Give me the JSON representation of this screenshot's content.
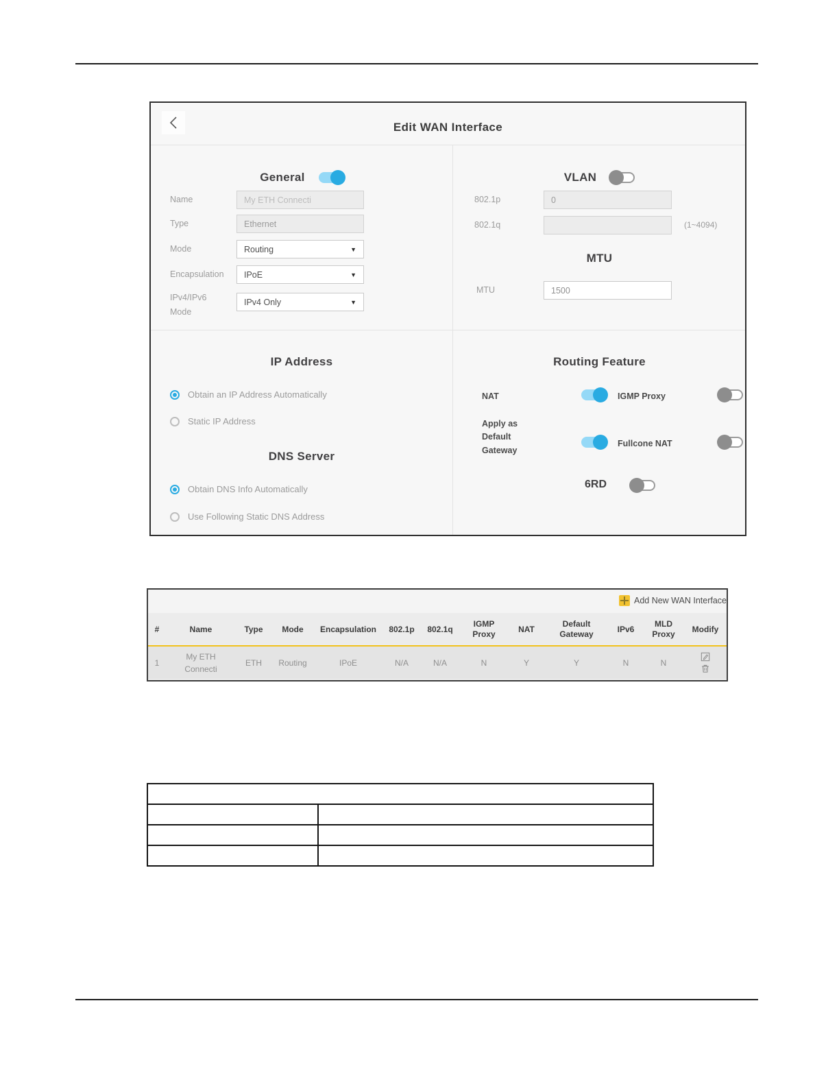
{
  "dialog": {
    "title": "Edit WAN Interface",
    "general": {
      "heading": "General",
      "name_label": "Name",
      "name_value": "My ETH Connecti",
      "type_label": "Type",
      "type_value": "Ethernet",
      "mode_label": "Mode",
      "mode_value": "Routing",
      "encap_label": "Encapsulation",
      "encap_value": "IPoE",
      "ipmode_label": "IPv4/IPv6 Mode",
      "ipmode_value": "IPv4 Only"
    },
    "vlan": {
      "heading": "VLAN",
      "p_label": "802.1p",
      "p_value": "0",
      "q_label": "802.1q",
      "q_hint": "(1~4094)"
    },
    "mtu": {
      "heading": "MTU",
      "label": "MTU",
      "value": "1500"
    },
    "ip": {
      "heading": "IP Address",
      "opt_auto": "Obtain an IP Address Automatically",
      "opt_static": "Static IP Address"
    },
    "dns": {
      "heading": "DNS Server",
      "opt_auto": "Obtain DNS Info Automatically",
      "opt_static": "Use Following Static DNS Address"
    },
    "routing": {
      "heading": "Routing Feature",
      "nat_label": "NAT",
      "igmp_label": "IGMP Proxy",
      "gateway_label": "Apply as Default Gateway",
      "fullcone_label": "Fullcone NAT",
      "sixrd_label": "6RD"
    },
    "states": {
      "general": true,
      "vlan": false,
      "ip_auto": true,
      "ip_static": false,
      "dns_auto": true,
      "dns_static": false,
      "nat": true,
      "igmp": false,
      "gateway": true,
      "fullcone": false,
      "sixrd": false
    }
  },
  "wan_table": {
    "add_label": "Add New WAN Interface",
    "columns": [
      "#",
      "Name",
      "Type",
      "Mode",
      "Encapsulation",
      "802.1p",
      "802.1q",
      "IGMP Proxy",
      "NAT",
      "Default Gateway",
      "IPv6",
      "MLD Proxy",
      "Modify"
    ],
    "row": {
      "num": "1",
      "name": "My ETH Connecti",
      "type": "ETH",
      "mode": "Routing",
      "encap": "IPoE",
      "p": "N/A",
      "q": "N/A",
      "igmp": "N",
      "nat": "Y",
      "gateway": "Y",
      "ipv6": "N",
      "mld": "N"
    }
  }
}
